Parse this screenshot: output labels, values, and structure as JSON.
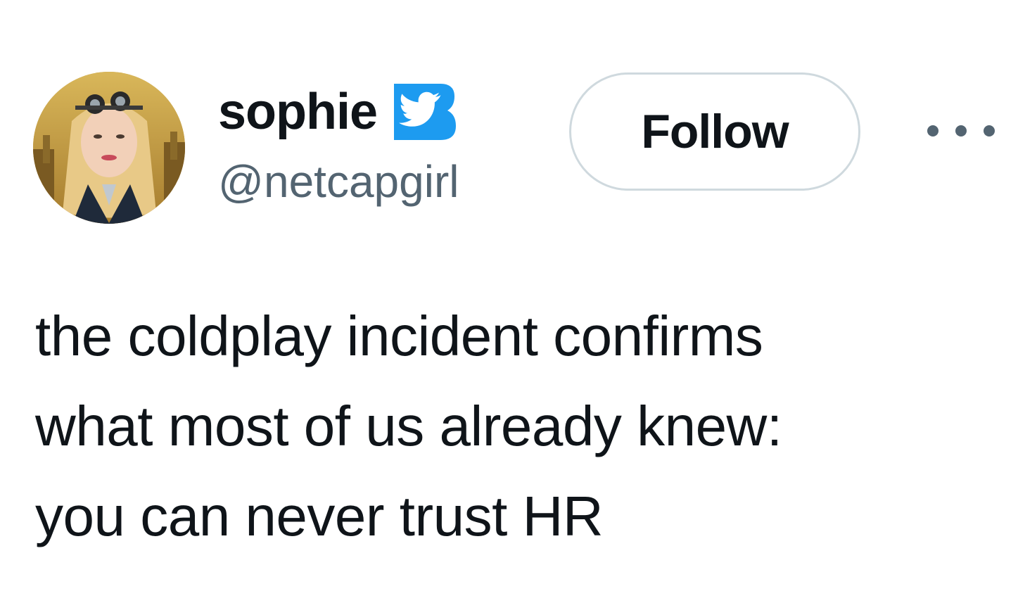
{
  "author": {
    "display_name": "sophie",
    "handle": "@netcapgirl",
    "verified_badge_icon": "twitter-bird-badge-icon",
    "avatar_icon": "profile-photo"
  },
  "actions": {
    "follow_label": "Follow",
    "more_icon": "more-options-icon"
  },
  "tweet": {
    "lines": [
      "the coldplay incident confirms",
      "what most of us already knew:",
      "you can never trust HR"
    ]
  },
  "colors": {
    "text_primary": "#0f1419",
    "text_secondary": "#536471",
    "badge_blue": "#1d9bf0",
    "button_border": "#cfd9de"
  }
}
